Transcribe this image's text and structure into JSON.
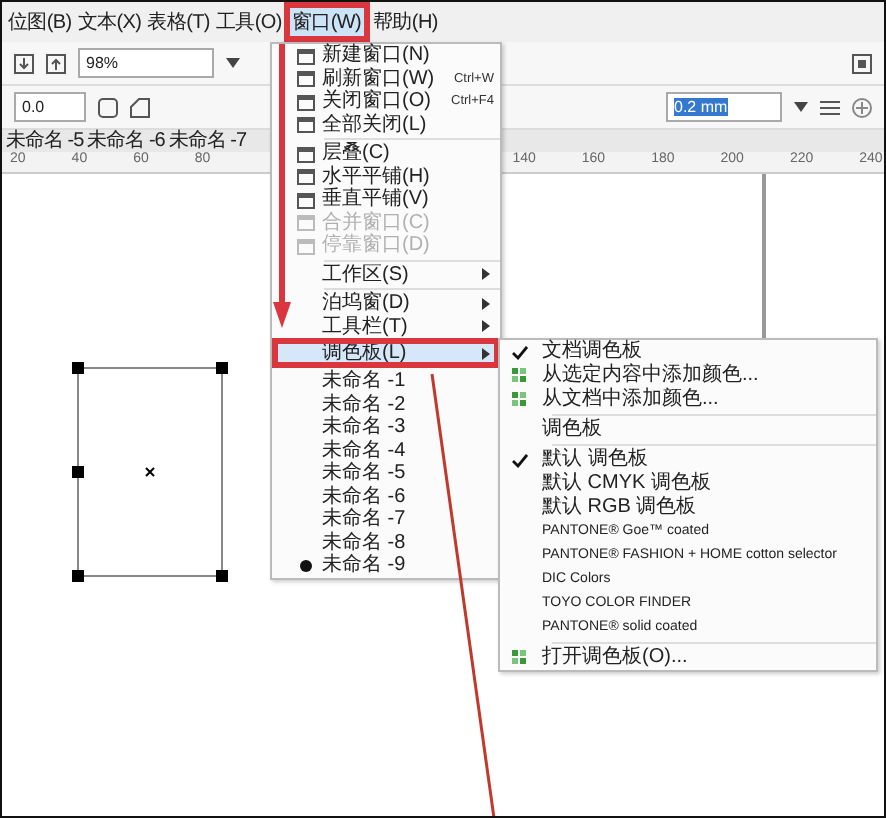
{
  "menubar": [
    {
      "label": "位图(B)",
      "selected": false
    },
    {
      "label": "文本(X)",
      "selected": false
    },
    {
      "label": "表格(T)",
      "selected": false
    },
    {
      "label": "工具(O)",
      "selected": false
    },
    {
      "label": "窗口(W)",
      "selected": true
    },
    {
      "label": "帮助(H)",
      "selected": false
    }
  ],
  "toolbar": {
    "zoom": "98%",
    "angle": "0.0",
    "outline": "0.2 mm"
  },
  "doc_tabs": [
    "未命名 -5",
    "未命名 -6",
    "未命名 -7"
  ],
  "ruler": [
    "20",
    "40",
    "60",
    "80",
    "140",
    "160",
    "180",
    "200",
    "220",
    "240"
  ],
  "window_menu": [
    {
      "kind": "action",
      "label": "新建窗口(N)",
      "disabled": false
    },
    {
      "kind": "action",
      "label": "刷新窗口(W)",
      "shortcut": "Ctrl+W",
      "disabled": false
    },
    {
      "kind": "action",
      "label": "关闭窗口(O)",
      "shortcut": "Ctrl+F4",
      "disabled": false
    },
    {
      "kind": "action",
      "label": "全部关闭(L)",
      "disabled": false
    },
    {
      "kind": "separator"
    },
    {
      "kind": "action",
      "label": "层叠(C)",
      "disabled": false
    },
    {
      "kind": "action",
      "label": "水平平铺(H)",
      "disabled": false
    },
    {
      "kind": "action",
      "label": "垂直平铺(V)",
      "disabled": false
    },
    {
      "kind": "action",
      "label": "合并窗口(C)",
      "disabled": true
    },
    {
      "kind": "action",
      "label": "停靠窗口(D)",
      "disabled": true
    },
    {
      "kind": "separator"
    },
    {
      "kind": "submenu",
      "label": "工作区(S)",
      "selected": false
    },
    {
      "kind": "separator"
    },
    {
      "kind": "submenu",
      "label": "泊坞窗(D)",
      "selected": false
    },
    {
      "kind": "submenu",
      "label": "工具栏(T)",
      "selected": false
    },
    {
      "kind": "submenu",
      "label": "调色板(L)",
      "selected": true
    },
    {
      "kind": "document",
      "label": "未命名 -1",
      "active": false
    },
    {
      "kind": "document",
      "label": "未命名 -2",
      "active": false
    },
    {
      "kind": "document",
      "label": "未命名 -3",
      "active": false
    },
    {
      "kind": "document",
      "label": "未命名 -4",
      "active": false
    },
    {
      "kind": "document",
      "label": "未命名 -5",
      "active": false
    },
    {
      "kind": "document",
      "label": "未命名 -6",
      "active": false
    },
    {
      "kind": "document",
      "label": "未命名 -7",
      "active": false
    },
    {
      "kind": "document",
      "label": "未命名 -8",
      "active": false
    },
    {
      "kind": "document",
      "label": "未命名 -9",
      "active": true
    }
  ],
  "palette_menu": [
    {
      "kind": "check",
      "label": "文档调色板",
      "checked": true
    },
    {
      "kind": "action",
      "label": "从选定内容中添加颜色..."
    },
    {
      "kind": "action",
      "label": "从文档中添加颜色..."
    },
    {
      "kind": "separator"
    },
    {
      "kind": "check",
      "label": "调色板",
      "checked": false
    },
    {
      "kind": "separator"
    },
    {
      "kind": "check",
      "label": "默认 调色板",
      "checked": true
    },
    {
      "kind": "check",
      "label": "默认 CMYK 调色板",
      "checked": false
    },
    {
      "kind": "check",
      "label": "默认 RGB 调色板",
      "checked": false
    },
    {
      "kind": "check",
      "label": "PANTONE® Goe™ coated",
      "checked": false
    },
    {
      "kind": "check",
      "label": "PANTONE® FASHION + HOME cotton selector",
      "checked": false
    },
    {
      "kind": "check",
      "label": "DIC Colors",
      "checked": false
    },
    {
      "kind": "check",
      "label": "TOYO COLOR FINDER",
      "checked": false
    },
    {
      "kind": "check",
      "label": "PANTONE® solid coated",
      "checked": false
    },
    {
      "kind": "separator"
    },
    {
      "kind": "action",
      "label": "打开调色板(O)..."
    }
  ]
}
